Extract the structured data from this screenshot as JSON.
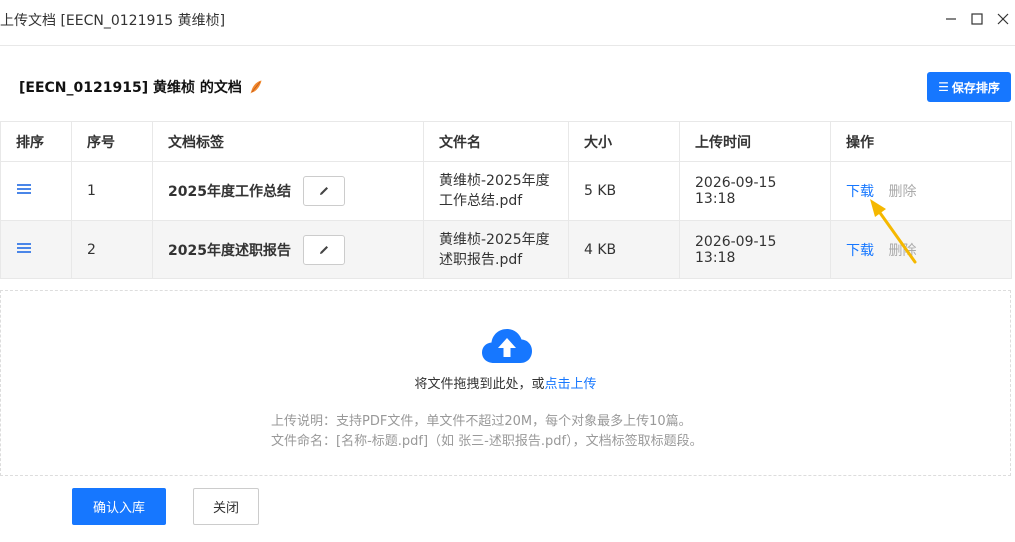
{
  "window": {
    "title": "上传文档 [EECN_0121915 黄维桢]",
    "controls": [
      "minimize-icon",
      "maximize-icon",
      "close-icon"
    ]
  },
  "header": {
    "title": "[EECN_0121915] 黄维桢 的文档",
    "title_icon": "feather-icon",
    "save_button": "保存排序",
    "save_button_icon": "list-icon"
  },
  "table": {
    "columns": [
      "排序",
      "序号",
      "文档标签",
      "文件名",
      "大小",
      "上传时间",
      "操作"
    ],
    "rows": [
      {
        "index": "1",
        "tag": "2025年度工作总结",
        "filename": "黄维桢-2025年度工作总结.pdf",
        "size": "5 KB",
        "uploaded": "2026-09-15 13:18",
        "download": "下载",
        "delete": "删除"
      },
      {
        "index": "2",
        "tag": "2025年度述职报告",
        "filename": "黄维桢-2025年度述职报告.pdf",
        "size": "4 KB",
        "uploaded": "2026-09-15 13:18",
        "download": "下载",
        "delete": "删除"
      }
    ]
  },
  "upload": {
    "icon": "cloud-upload-icon",
    "drop_text": "将文件拖拽到此处，或",
    "click_text": "点击上传",
    "hint_line1": "上传说明：支持PDF文件，单文件不超过20M，每个对象最多上传10篇。",
    "hint_line2": "文件命名：[名称-标题.pdf]（如 张三-述职报告.pdf），文档标签取标题段。"
  },
  "footer": {
    "confirm": "确认入库",
    "close": "关闭"
  },
  "colors": {
    "primary": "#1677ff",
    "handle": "#4a86e8",
    "border": "#e8e8e8",
    "row_alt": "#f5f5f5",
    "muted": "#999999",
    "annotation_arrow": "#f5b800"
  }
}
